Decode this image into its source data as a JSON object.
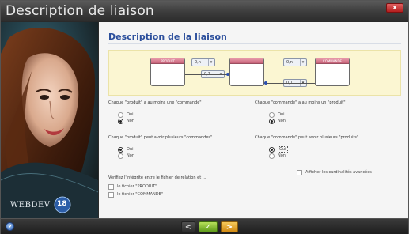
{
  "window": {
    "title": "Description de liaison",
    "close_label": "x"
  },
  "sidebar": {
    "logo_text": "WEBDEV",
    "logo_badge": "18"
  },
  "content": {
    "heading": "Description de la liaison",
    "diagram": {
      "entity_left": "PRODUIT",
      "entity_right": "COMMANDE",
      "card_left_top": "0,n",
      "card_left_bottom": "0,1",
      "card_right_top": "0,n",
      "card_right_bottom": "0,1"
    },
    "q1": {
      "label": "Chaque \"produit\" a au moins une \"commande\"",
      "options": [
        "Oui",
        "Non"
      ],
      "selected": "Non"
    },
    "q2": {
      "label": "Chaque \"commande\" a au moins un \"produit\"",
      "options": [
        "Oui",
        "Non"
      ],
      "selected": "Non"
    },
    "q3": {
      "label": "Chaque \"produit\" peut avoir plusieurs \"commandes\"",
      "options": [
        "Oui",
        "Non"
      ],
      "selected": "Oui"
    },
    "q4": {
      "label": "Chaque \"commande\" peut avoir plusieurs \"produits\"",
      "options": [
        "Oui",
        "Non"
      ],
      "selected": "Oui"
    },
    "show_cardinalities_label": "Afficher les cardinalités avancées",
    "integrity": {
      "label": "Vérifiez l'intégrité entre le fichier de relation et ...",
      "files": [
        "le fichier \"PRODUIT\"",
        "le fichier \"COMMANDE\""
      ]
    }
  },
  "bottombar": {
    "help_label": "?",
    "prev_label": "<",
    "ok_label": "✓",
    "next_label": ">"
  }
}
